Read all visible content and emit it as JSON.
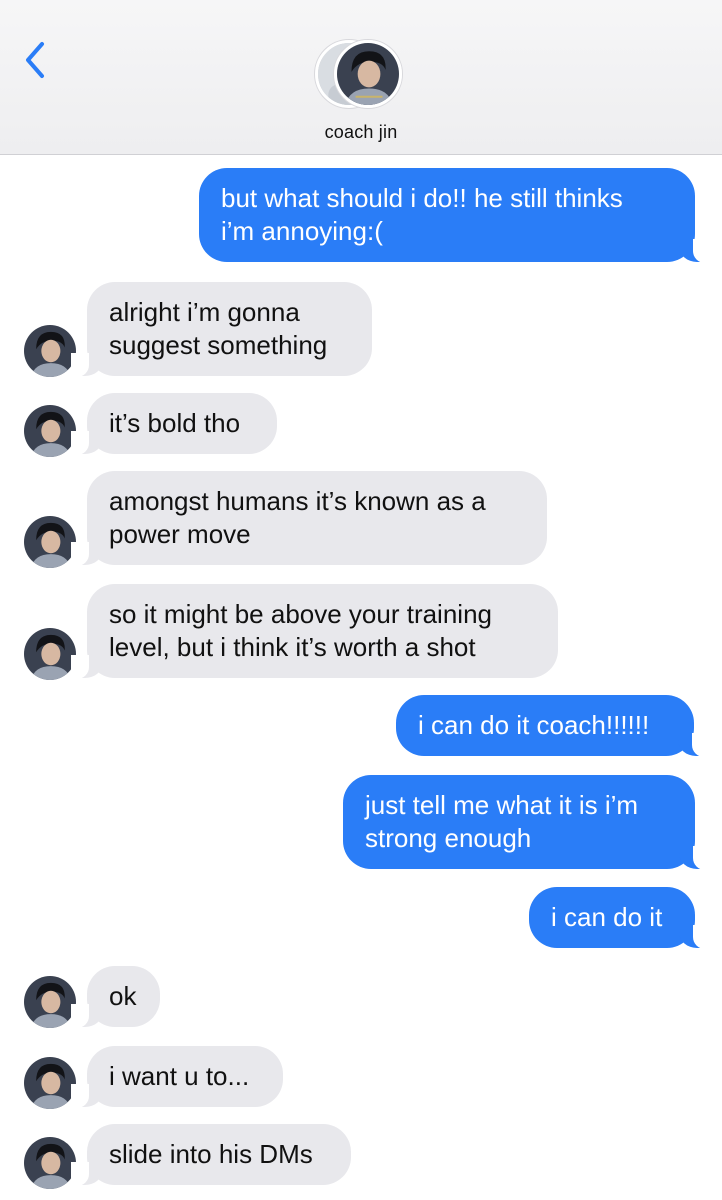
{
  "header": {
    "contact_name": "coach jin",
    "back_icon": "chevron-left-icon",
    "accent": "#2a7df7"
  },
  "messages": [
    {
      "from": "me",
      "text": "but what should i do!! he still thinks\ni’m annoying:("
    },
    {
      "from": "coach",
      "text": "alright i’m gonna\nsuggest something"
    },
    {
      "from": "coach",
      "text": "it’s bold tho"
    },
    {
      "from": "coach",
      "text": "amongst humans it’s known as a\npower move"
    },
    {
      "from": "coach",
      "text": "so it might be above your training\nlevel, but i think it’s worth a shot"
    },
    {
      "from": "me",
      "text": "i can do it coach!!!!!!"
    },
    {
      "from": "me",
      "text": "just tell me what it is i’m\nstrong enough"
    },
    {
      "from": "me",
      "text": "i can do it"
    },
    {
      "from": "coach",
      "text": "ok"
    },
    {
      "from": "coach",
      "text": "i want u to..."
    },
    {
      "from": "coach",
      "text": "slide into his DMs"
    }
  ],
  "colors": {
    "sent_bubble": "#2a7df7",
    "received_bubble": "#e8e8ec"
  }
}
